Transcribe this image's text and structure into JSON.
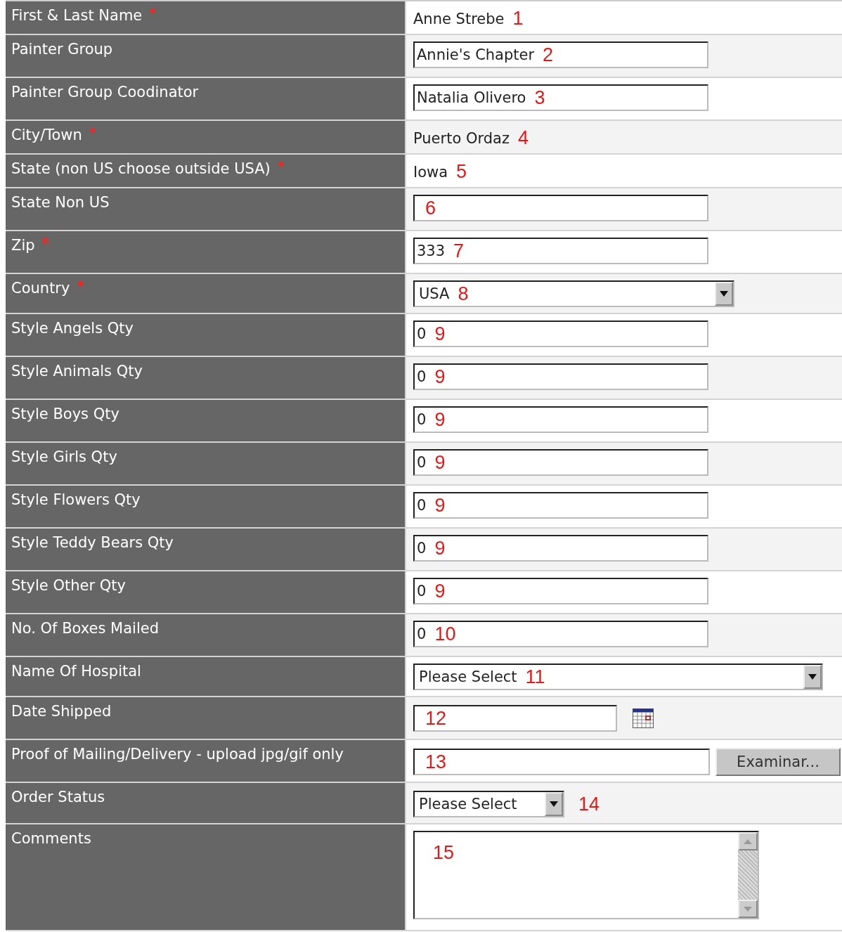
{
  "form_rows": [
    {
      "label": "First & Last Name",
      "required_mark": "*",
      "kind": "text",
      "value": "Anne Strebe",
      "annotation": "1"
    },
    {
      "label": "Painter Group",
      "kind": "input",
      "value": "Annie's Chapter",
      "annotation": "2"
    },
    {
      "label": "Painter Group Coodinator",
      "kind": "input",
      "value": "Natalia Olivero",
      "annotation": "3"
    },
    {
      "label": "City/Town",
      "required_mark": "*",
      "kind": "text",
      "value": "Puerto Ordaz",
      "annotation": "4"
    },
    {
      "label": "State (non US choose outside USA)",
      "required_mark": "*",
      "kind": "text",
      "value": "Iowa",
      "annotation": "5"
    },
    {
      "label": "State Non US",
      "kind": "input",
      "annotation": "6"
    },
    {
      "label": "Zip",
      "required_mark": "*",
      "kind": "input",
      "value": "333",
      "annotation": "7"
    },
    {
      "label": "Country",
      "required_mark": "*",
      "kind": "select",
      "value": "USA",
      "annotation": "8"
    },
    {
      "label": "Style Angels Qty",
      "kind": "input",
      "value": "0",
      "annotation": "9"
    },
    {
      "label": "Style Animals Qty",
      "kind": "input",
      "value": "0",
      "annotation": "9"
    },
    {
      "label": "Style Boys Qty",
      "kind": "input",
      "value": "0",
      "annotation": "9"
    },
    {
      "label": "Style Girls Qty",
      "kind": "input",
      "value": "0",
      "annotation": "9"
    },
    {
      "label": "Style Flowers Qty",
      "kind": "input",
      "value": "0",
      "annotation": "9"
    },
    {
      "label": "Style Teddy Bears Qty",
      "kind": "input",
      "value": "0",
      "annotation": "9"
    },
    {
      "label": "Style Other Qty",
      "kind": "input",
      "value": "0",
      "annotation": "9"
    },
    {
      "label": "No. Of Boxes Mailed",
      "kind": "input",
      "value": "0",
      "annotation": "10"
    },
    {
      "label": "Name Of Hospital",
      "kind": "wide_select",
      "value": "Please Select",
      "annotation": "11"
    },
    {
      "label": "Date Shipped",
      "kind": "date",
      "annotation": "12"
    },
    {
      "label": "Proof of Mailing/Delivery - upload jpg/gif only",
      "kind": "file",
      "button": "Examinar...",
      "annotation": "13"
    },
    {
      "label": "Order Status",
      "kind": "small_select",
      "value": "Please Select",
      "annotation": "14"
    },
    {
      "label": "Comments",
      "kind": "textarea",
      "annotation": "15"
    }
  ]
}
